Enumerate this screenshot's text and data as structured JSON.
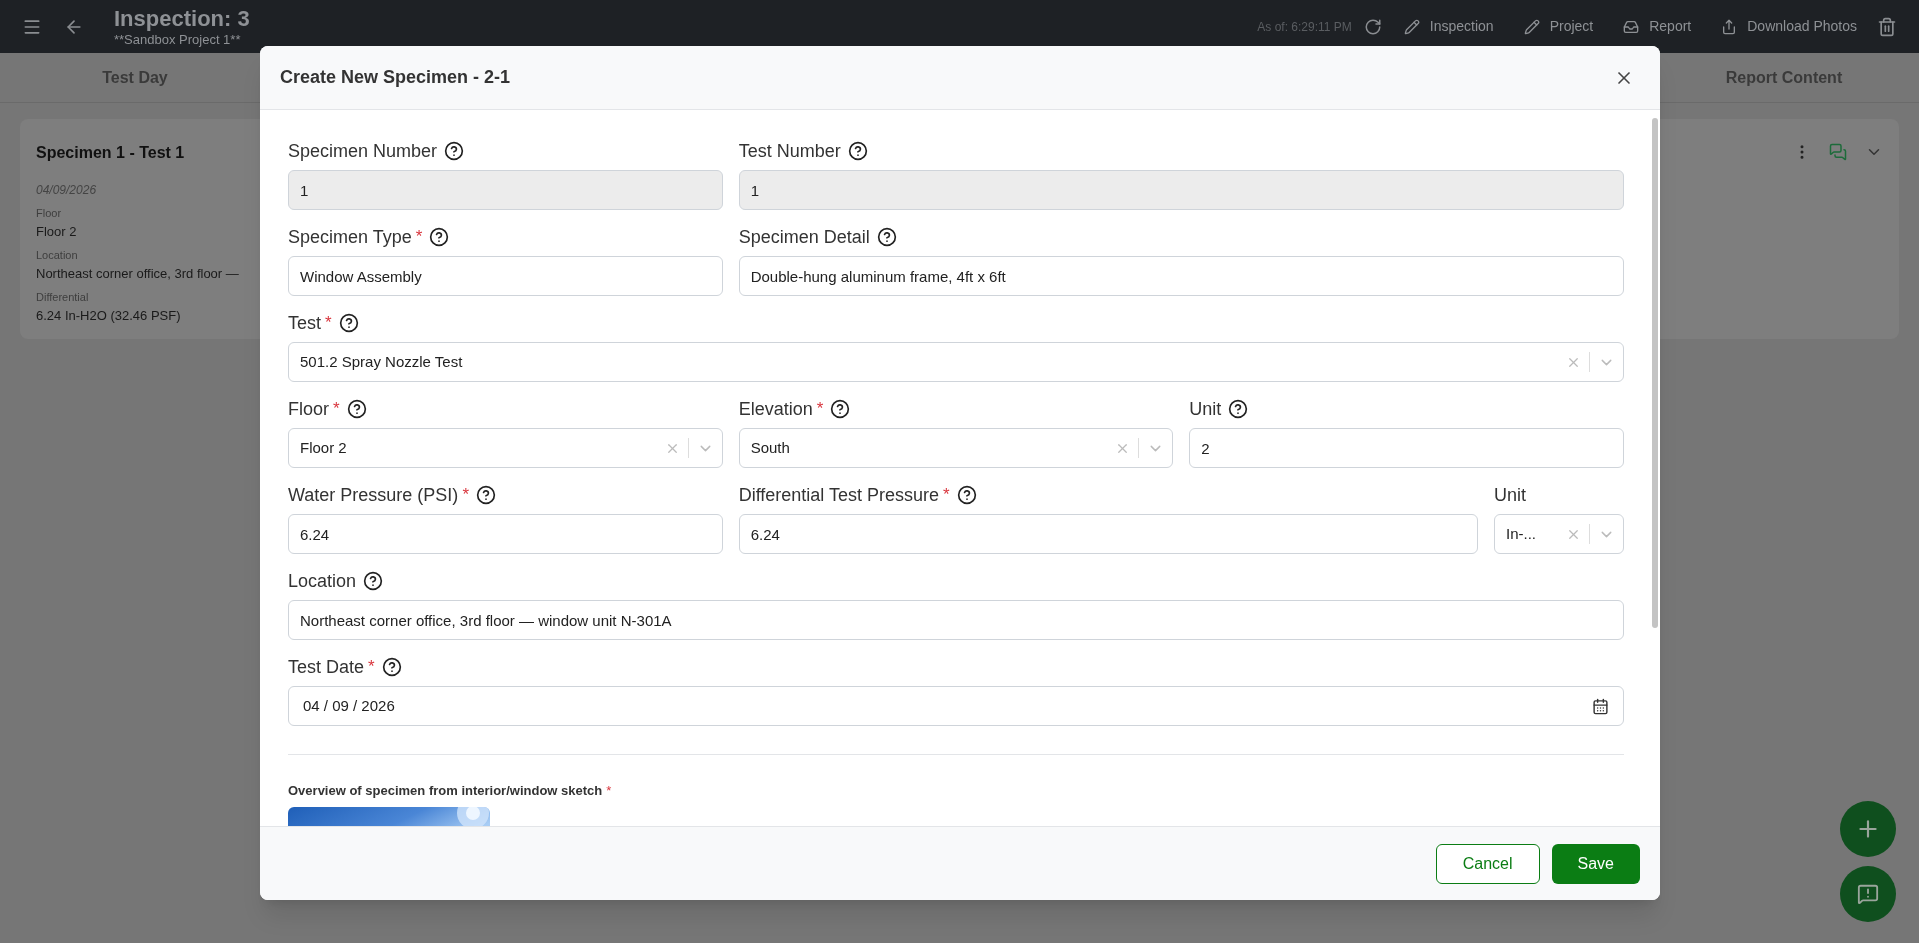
{
  "top_bar": {
    "title": "Inspection: 3",
    "subtitle": "**Sandbox Project 1**",
    "timestamp": "As of: 6:29:11 PM",
    "actions": [
      {
        "label": "Inspection",
        "kind": "edit"
      },
      {
        "label": "Project",
        "kind": "edit"
      },
      {
        "label": "Report",
        "kind": "report"
      },
      {
        "label": "Download Photos",
        "kind": "share"
      }
    ]
  },
  "tabs": [
    {
      "label": "Test Day"
    },
    {
      "label": "Report Content"
    }
  ],
  "card": {
    "title": "Specimen 1 - Test 1",
    "date": "04/09/2026",
    "fields": [
      {
        "label": "Floor",
        "value": "Floor 2"
      },
      {
        "label": "Location",
        "value": "Northeast corner office, 3rd floor —"
      },
      {
        "label": "Differential",
        "value": "6.24 In-H2O (32.46 PSF)"
      }
    ]
  },
  "modal": {
    "title": "Create New Specimen - 2-1",
    "rows": [
      [
        {
          "label": "Specimen Number",
          "kind": "text",
          "value": "1",
          "help": true,
          "disabled": true
        },
        {
          "label": "Test Number",
          "kind": "text",
          "value": "1",
          "help": true,
          "disabled": true
        }
      ],
      [
        {
          "label": "Specimen Type",
          "required_mark": "*",
          "kind": "text",
          "value": "Window Assembly",
          "help": true,
          "disabled": false
        },
        {
          "label": "Specimen Detail",
          "kind": "text",
          "value": "Double-hung aluminum frame, 4ft x 6ft",
          "help": true,
          "disabled": false
        }
      ],
      [
        {
          "label": "Test",
          "required_mark": "*",
          "kind": "select",
          "value": "501.2 Spray Nozzle Test",
          "help": true,
          "disabled": false
        }
      ],
      [
        {
          "label": "Floor",
          "required_mark": "*",
          "kind": "select",
          "value": "Floor 2",
          "help": true,
          "disabled": false
        },
        {
          "label": "Elevation",
          "required_mark": "*",
          "kind": "select",
          "value": "South",
          "help": true,
          "disabled": false
        },
        {
          "label": "Unit",
          "kind": "text",
          "value": "2",
          "help": true,
          "disabled": false
        }
      ],
      [
        {
          "label": "Water Pressure (PSI)",
          "required_mark": "*",
          "kind": "text",
          "value": "6.24",
          "help": true,
          "disabled": false
        },
        {
          "label": "Differential Test Pressure",
          "required_mark": "*",
          "kind": "text",
          "value": "6.24",
          "help": true,
          "disabled": false
        },
        {
          "label": "Unit",
          "kind": "select",
          "value": "In-...",
          "help": false,
          "disabled": false
        }
      ],
      [
        {
          "label": "Location",
          "kind": "text",
          "value": "Northeast corner office, 3rd floor — window unit N-301A",
          "help": true,
          "disabled": false
        }
      ],
      [
        {
          "label": "Test Date",
          "required_mark": "*",
          "kind": "date",
          "value": "04 / 09 / 2026",
          "help": true,
          "disabled": false
        }
      ]
    ],
    "section": {
      "label": "Overview of specimen from interior/window sketch",
      "required_mark": "*"
    },
    "buttons": [
      {
        "label": "Cancel",
        "kind": "secondary"
      },
      {
        "label": "Save",
        "kind": "primary"
      }
    ]
  }
}
